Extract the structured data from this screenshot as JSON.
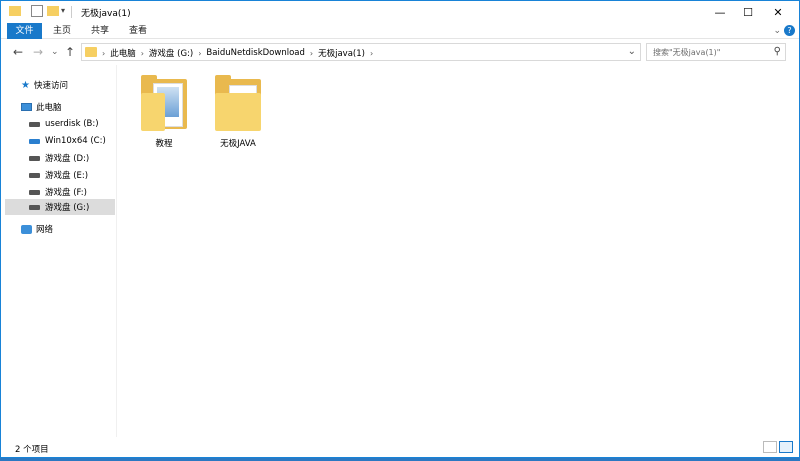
{
  "window": {
    "title": "无极java(1)",
    "minimize": "—",
    "maximize": "☐",
    "close": "✕"
  },
  "ribbon": {
    "tabs": [
      "文件",
      "主页",
      "共享",
      "查看"
    ],
    "toggle": "⌄",
    "help": "?"
  },
  "nav": {
    "back": "←",
    "forward": "→",
    "recent": "⌄",
    "up": "↑",
    "breadcrumbs": [
      "此电脑",
      "游戏盘 (G:)",
      "BaiduNetdiskDownload",
      "无极java(1)"
    ],
    "separator": "›",
    "refresh": "⌄",
    "search_placeholder": "搜索\"无极java(1)\"",
    "search_icon": "⚲"
  },
  "sidebar": {
    "items": [
      {
        "label": "快速访问",
        "icon": "star-icon"
      },
      {
        "label": "此电脑",
        "icon": "computer-icon"
      },
      {
        "label": "userdisk (B:)",
        "icon": "drive-icon"
      },
      {
        "label": "Win10x64 (C:)",
        "icon": "windows-drive-icon"
      },
      {
        "label": "游戏盘 (D:)",
        "icon": "drive-icon"
      },
      {
        "label": "游戏盘 (E:)",
        "icon": "drive-icon"
      },
      {
        "label": "游戏盘 (F:)",
        "icon": "drive-icon"
      },
      {
        "label": "游戏盘 (G:)",
        "icon": "drive-icon"
      },
      {
        "label": "网络",
        "icon": "network-icon"
      }
    ],
    "selected_index": 7
  },
  "files": [
    {
      "name": "教程"
    },
    {
      "name": "无极JAVA"
    }
  ],
  "status": {
    "count": "2 个项目"
  },
  "colors": {
    "accent": "#1979ca",
    "folder": "#f7d56e",
    "selected": "#dcdcdc"
  }
}
